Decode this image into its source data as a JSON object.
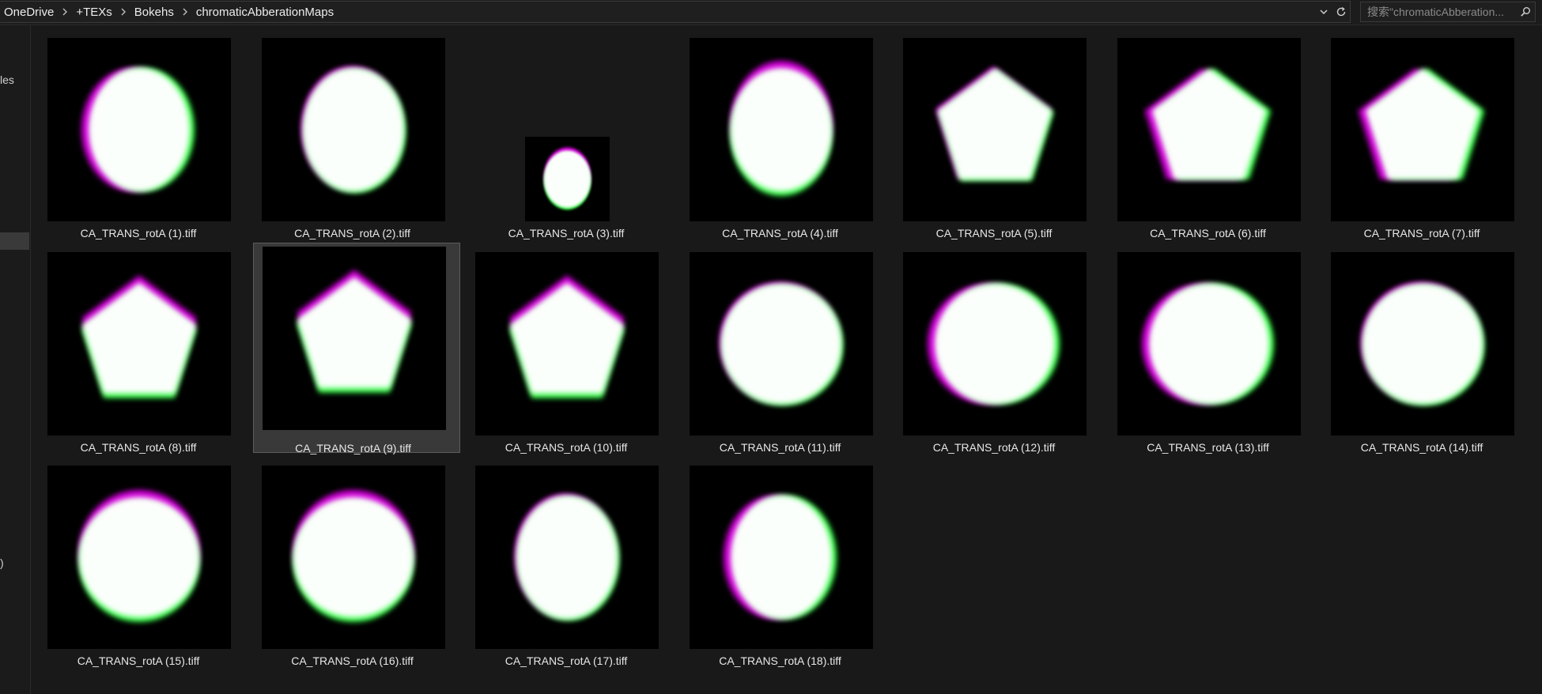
{
  "breadcrumb": [
    "OneDrive",
    "+TEXs",
    "Bokehs",
    "chromaticAbberationMaps"
  ],
  "search": {
    "placeholder": "搜索\"chromaticAbberation..."
  },
  "nav": {
    "partial_labels": [
      "les",
      ")"
    ]
  },
  "colors": {
    "background": "#191919",
    "magenta": "#d000d8",
    "green": "#38ff4a",
    "selection": "#393939"
  },
  "icons": {
    "breadcrumb_sep": "chevron-right-icon",
    "history": "chevron-down-icon",
    "refresh": "refresh-icon",
    "search": "search-icon"
  },
  "files": [
    {
      "name": "CA_TRANS_rotA (1).tiff",
      "shape": "ellipse",
      "fringe": "left",
      "scale": 1.0
    },
    {
      "name": "CA_TRANS_rotA (2).tiff",
      "shape": "ellipse",
      "fringe": "none",
      "scale": 1.0
    },
    {
      "name": "CA_TRANS_rotA (3).tiff",
      "shape": "ellipse",
      "fringe": "top",
      "scale": 0.46
    },
    {
      "name": "CA_TRANS_rotA (4).tiff",
      "shape": "ellipse",
      "fringe": "top",
      "scale": 1.0
    },
    {
      "name": "CA_TRANS_rotA (5).tiff",
      "shape": "pentagon",
      "fringe": "none",
      "scale": 1.0
    },
    {
      "name": "CA_TRANS_rotA (6).tiff",
      "shape": "pentagon",
      "fringe": "left",
      "scale": 1.0
    },
    {
      "name": "CA_TRANS_rotA (7).tiff",
      "shape": "pentagon",
      "fringe": "left",
      "scale": 1.0
    },
    {
      "name": "CA_TRANS_rotA (8).tiff",
      "shape": "pentagon",
      "fringe": "top",
      "scale": 1.0
    },
    {
      "name": "CA_TRANS_rotA (9).tiff",
      "shape": "pentagon",
      "fringe": "top",
      "scale": 1.0,
      "selected": true
    },
    {
      "name": "CA_TRANS_rotA (10).tiff",
      "shape": "pentagon",
      "fringe": "top",
      "scale": 1.0
    },
    {
      "name": "CA_TRANS_rotA (11).tiff",
      "shape": "circle",
      "fringe": "none",
      "scale": 1.0
    },
    {
      "name": "CA_TRANS_rotA (12).tiff",
      "shape": "circle",
      "fringe": "left",
      "scale": 1.0
    },
    {
      "name": "CA_TRANS_rotA (13).tiff",
      "shape": "circle",
      "fringe": "left",
      "scale": 1.0
    },
    {
      "name": "CA_TRANS_rotA (14).tiff",
      "shape": "circle",
      "fringe": "none",
      "scale": 1.0
    },
    {
      "name": "CA_TRANS_rotA (15).tiff",
      "shape": "circle",
      "fringe": "top",
      "scale": 1.0
    },
    {
      "name": "CA_TRANS_rotA (16).tiff",
      "shape": "circle",
      "fringe": "top",
      "scale": 1.0
    },
    {
      "name": "CA_TRANS_rotA (17).tiff",
      "shape": "ellipse",
      "fringe": "none",
      "scale": 1.0
    },
    {
      "name": "CA_TRANS_rotA (18).tiff",
      "shape": "ellipse",
      "fringe": "left",
      "scale": 1.0
    }
  ]
}
